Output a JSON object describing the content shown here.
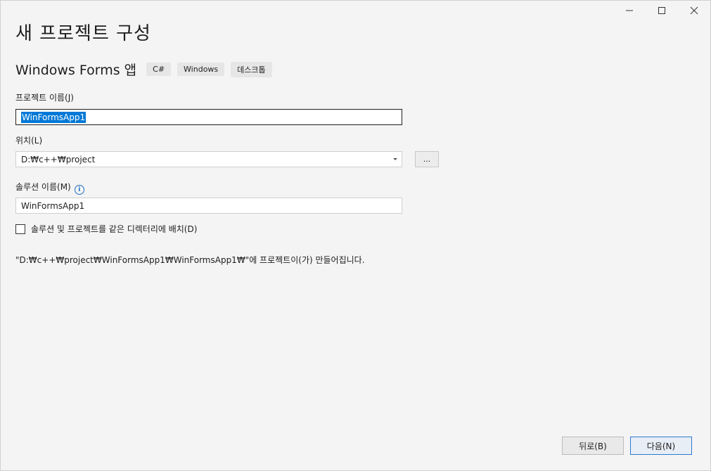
{
  "title": "새 프로젝트 구성",
  "template": {
    "name": "Windows Forms 앱",
    "tags": [
      "C#",
      "Windows",
      "데스크톱"
    ]
  },
  "project_name": {
    "label": "프로젝트 이름(J)",
    "value": "WinFormsApp1"
  },
  "location": {
    "label": "위치(L)",
    "value": "D:₩c++₩project",
    "browse_label": "..."
  },
  "solution_name": {
    "label": "솔루션 이름(M)",
    "value": "WinFormsApp1"
  },
  "same_dir_checkbox": {
    "label": "솔루션 및 프로젝트를 같은 디렉터리에 배치(D)",
    "checked": false
  },
  "creation_note": "\"D:₩c++₩project₩WinFormsApp1₩WinFormsApp1₩\"에 프로젝트이(가) 만들어집니다.",
  "buttons": {
    "back": "뒤로(B)",
    "next": "다음(N)"
  },
  "icons": {
    "minimize": "minimize-icon",
    "maximize": "maximize-icon",
    "close": "close-icon",
    "info": "info-icon",
    "dropdown": "chevron-down-icon"
  },
  "colors": {
    "accent": "#0078d7",
    "background": "#f4f4f4",
    "info": "#1c6fc4"
  }
}
